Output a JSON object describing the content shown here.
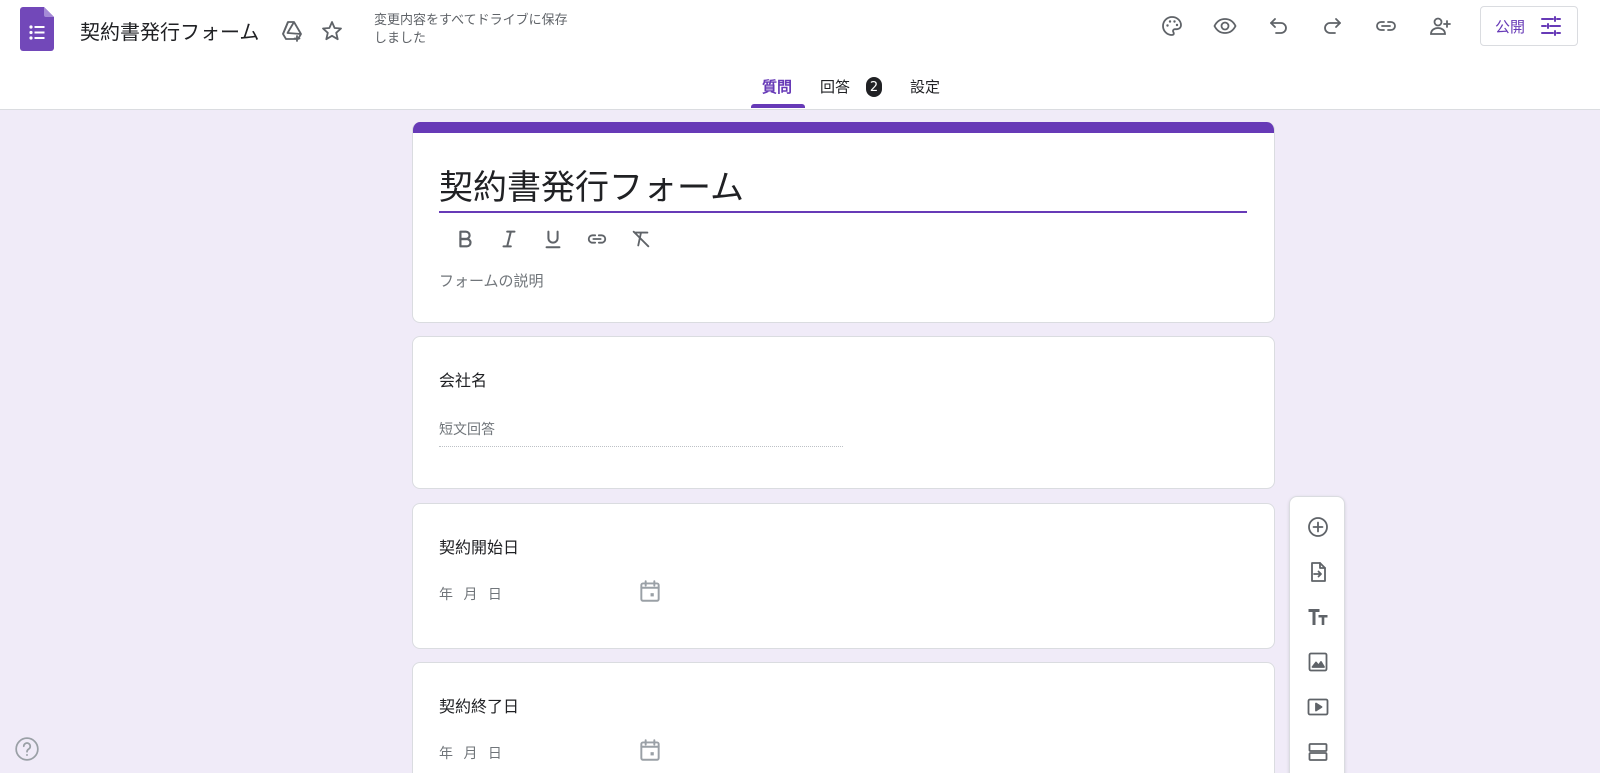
{
  "header": {
    "doc_title": "契約書発行フォーム",
    "save_status": "変更内容をすべてドライブに保存しました",
    "publish_label": "公開",
    "accent_color": "#673ab7"
  },
  "tabs": [
    {
      "label": "質問",
      "active": true
    },
    {
      "label": "回答",
      "badge": "2"
    },
    {
      "label": "設定"
    }
  ],
  "form": {
    "title": "契約書発行フォーム",
    "description_placeholder": "フォームの説明",
    "questions": [
      {
        "title": "会社名",
        "type": "short-answer",
        "placeholder": "短文回答"
      },
      {
        "title": "契約開始日",
        "type": "date",
        "placeholder": "年 月 日"
      },
      {
        "title": "契約終了日",
        "type": "date",
        "placeholder": "年 月 日"
      }
    ]
  },
  "icons": {
    "header": [
      "palette-icon",
      "preview-eye-icon",
      "undo-icon",
      "redo-icon",
      "link-icon",
      "add-collaborator-icon",
      "tune-icon"
    ],
    "format": [
      "bold-icon",
      "italic-icon",
      "underline-icon",
      "link-icon",
      "clear-format-icon"
    ],
    "side_toolbar": [
      "add-question-icon",
      "import-questions-icon",
      "add-title-icon",
      "add-image-icon",
      "add-video-icon",
      "add-section-icon"
    ]
  }
}
